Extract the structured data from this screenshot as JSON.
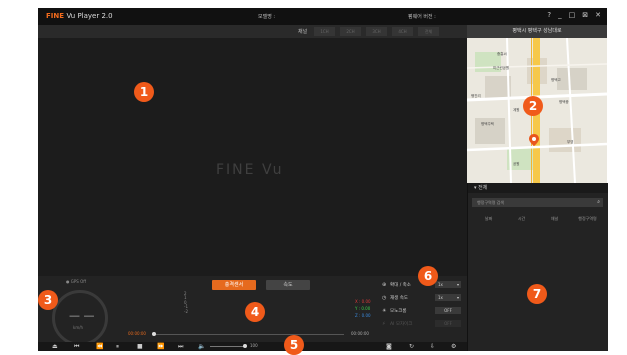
{
  "title_bar": {
    "brand": "FINE",
    "app_name": "Vu Player 2.0",
    "center_text": "모델명 :",
    "version_text": "펌웨어 버전 :",
    "window_controls": [
      "?",
      "_",
      "□",
      "⊠",
      "✕"
    ]
  },
  "toolbar": {
    "channel_label": "채널",
    "channel_buttons": [
      "1CH",
      "2CH",
      "3CH",
      "4CH",
      "전체"
    ]
  },
  "video": {
    "watermark": "FINE Vu"
  },
  "map": {
    "location": "평택시 평택구 성남대로",
    "labels": [
      "중흥씨",
      "미근린공원",
      "평택고",
      "행진리",
      "계원",
      "평택중",
      "평택주택",
      "부영",
      "공원"
    ]
  },
  "list_panel": {
    "header": "전체",
    "search_placeholder": "행정구역명 검색",
    "columns": [
      "날짜",
      "시간",
      "채널",
      "행정구역명"
    ]
  },
  "gps_panel": {
    "status": "GPS Off",
    "speed": "— —",
    "unit": "km/h"
  },
  "sensor_panel": {
    "tabs": [
      "충격센서",
      "속도"
    ],
    "active_tab": "충격센서",
    "scale": [
      "2",
      "1",
      "0",
      "-1",
      "-2"
    ],
    "axes": [
      {
        "label": "X : 0.00",
        "color": "#e03a3a"
      },
      {
        "label": "Y : 0.00",
        "color": "#3ad24a"
      },
      {
        "label": "Z : 0.00",
        "color": "#3a8ce0"
      }
    ],
    "time_start": "00:00:00",
    "time_end": "00:00:00",
    "progress": 0.0
  },
  "settings": {
    "zoom_label": "확대 / 축소",
    "zoom_value": "1x",
    "speed_label": "재생 속도",
    "speed_value": "1x",
    "mosaic_label": "모노크롬",
    "mosaic_value": "OFF",
    "ai_label": "AI 모자이크",
    "ai_value": "OFF"
  },
  "controls": {
    "buttons": [
      "eject",
      "prev-file",
      "rewind",
      "pause",
      "stop",
      "fast-forward",
      "next-file",
      "volume"
    ],
    "volume": 100,
    "volume_text": "100"
  },
  "badges": [
    "1",
    "2",
    "3",
    "4",
    "5",
    "6",
    "7"
  ],
  "accent_color": "#f05a1a"
}
